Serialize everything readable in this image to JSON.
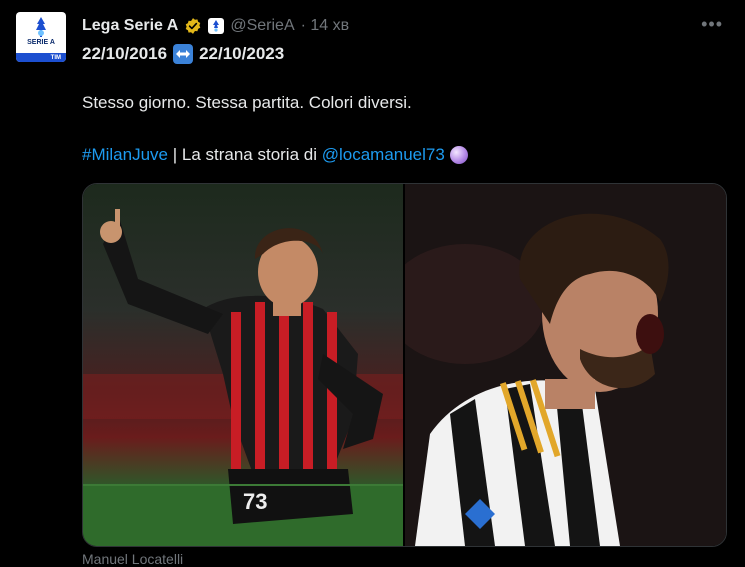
{
  "account": {
    "avatar_label": "SERIE A",
    "avatar_sponsor": "TIM",
    "name": "Lega Serie A",
    "handle": "@SerieA",
    "time": "· 14 хв",
    "more_icon": "more-icon"
  },
  "tweet": {
    "date_from": "22/10/2016",
    "swap_icon": "left-right-arrow-icon",
    "date_to": "22/10/2023",
    "line1": "Stesso giorno. Stessa partita. Colori diversi.",
    "hashtag": "#MilanJuve",
    "separator": " | La strana storia di ",
    "mention": "@locamanuel73",
    "emoji_icon": "crystal-ball-icon"
  },
  "media": {
    "left_alt": "AC Milan player celebrating with raised finger, number 73",
    "right_alt": "Juventus player shouting in celebration",
    "caption": "Manuel Locatelli"
  },
  "colors": {
    "background": "#000000",
    "text": "#e7e9ea",
    "muted": "#71767b",
    "link": "#1d9bf0",
    "verified_gold": "#e2b719"
  }
}
